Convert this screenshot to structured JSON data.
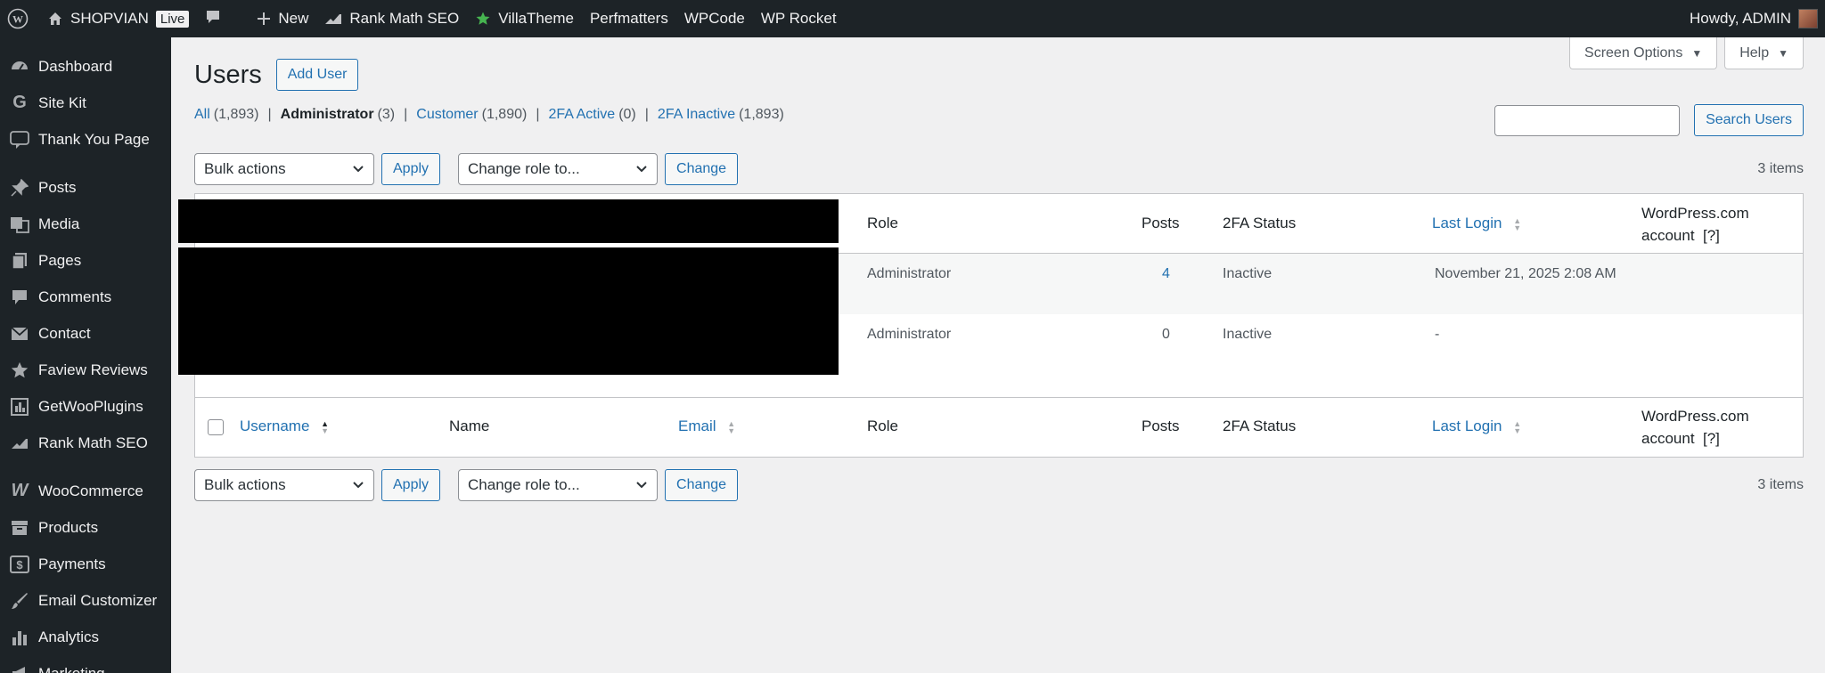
{
  "admin_bar": {
    "site_name": "SHOPVIAN",
    "live_badge": "Live",
    "items": [
      "New",
      "Rank Math SEO",
      "VillaTheme",
      "Perfmatters",
      "WPCode",
      "WP Rocket"
    ],
    "greeting": "Howdy, ADMIN"
  },
  "sidebar": {
    "groups": [
      [
        "Dashboard",
        "Site Kit",
        "Thank You Page"
      ],
      [
        "Posts",
        "Media",
        "Pages",
        "Comments",
        "Contact",
        "Faview Reviews",
        "GetWooPlugins",
        "Rank Math SEO"
      ],
      [
        "WooCommerce",
        "Products",
        "Payments",
        "Email Customizer",
        "Analytics",
        "Marketing"
      ]
    ]
  },
  "screen_meta": {
    "screen_options": "Screen Options",
    "help": "Help"
  },
  "page": {
    "title": "Users",
    "add_user": "Add User"
  },
  "filters": [
    {
      "label": "All",
      "count": "(1,893)",
      "current": false
    },
    {
      "label": "Administrator",
      "count": "(3)",
      "current": true
    },
    {
      "label": "Customer",
      "count": "(1,890)",
      "current": false
    },
    {
      "label": "2FA Active",
      "count": "(0)",
      "current": false
    },
    {
      "label": "2FA Inactive",
      "count": "(1,893)",
      "current": false
    }
  ],
  "search": {
    "button": "Search Users",
    "value": ""
  },
  "tablenav": {
    "bulk_actions": "Bulk actions",
    "apply": "Apply",
    "change_role": "Change role to...",
    "change": "Change",
    "items_count": "3 items"
  },
  "table": {
    "columns": {
      "username": "Username",
      "name": "Name",
      "email": "Email",
      "role": "Role",
      "posts": "Posts",
      "twofa": "2FA Status",
      "last_login": "Last Login",
      "wpcom_line1": "WordPress.com",
      "wpcom_line2": "account  [?]"
    },
    "rows": [
      {
        "role": "Administrator",
        "posts": "4",
        "twofa": "Inactive",
        "last_login": "November 21, 2025 2:08 AM"
      },
      {
        "role": "Administrator",
        "posts": "0",
        "twofa": "Inactive",
        "last_login": "-"
      }
    ]
  }
}
